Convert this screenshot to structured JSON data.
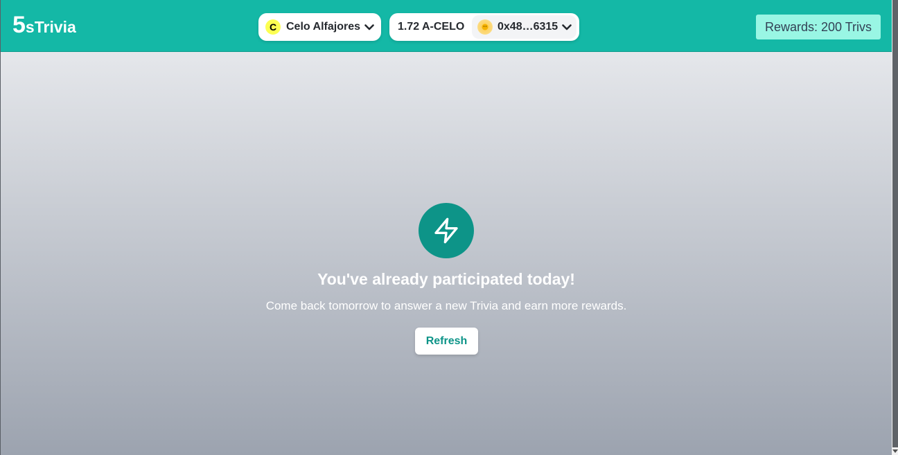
{
  "header": {
    "logo_big": "5",
    "logo_small": "sTrivia",
    "chain": {
      "label": "Celo Alfajores",
      "icon": "celo-logo-icon",
      "icon_letter": "C"
    },
    "account": {
      "balance": "1.72 A-CELO",
      "address": "0x48…6315",
      "avatar_icon": "emoji-avatar-icon"
    },
    "rewards": "Rewards: 200 Trivs"
  },
  "main": {
    "icon": "lightning-bolt-icon",
    "headline": "You've already participated today!",
    "subtext": "Come back tomorrow to answer a new Trivia and earn more rewards.",
    "refresh_label": "Refresh"
  },
  "colors": {
    "header_bg": "#14b8a6",
    "accent": "#0d9488",
    "rewards_bg": "#99f6e4",
    "celo_yellow": "#fcff52"
  }
}
